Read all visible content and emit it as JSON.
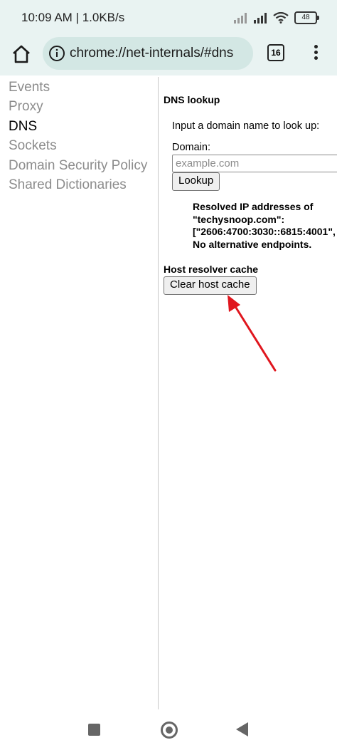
{
  "status_bar": {
    "time": "10:09 AM | 1.0KB/s",
    "battery": "48"
  },
  "toolbar": {
    "url": "chrome://net-internals/#dns",
    "tab_count": "16"
  },
  "sidebar": {
    "items": [
      {
        "label": "Events",
        "active": false
      },
      {
        "label": "Proxy",
        "active": false
      },
      {
        "label": "DNS",
        "active": true
      },
      {
        "label": "Sockets",
        "active": false
      },
      {
        "label": "Domain Security Policy",
        "active": false
      },
      {
        "label": "Shared Dictionaries",
        "active": false
      }
    ]
  },
  "dns_lookup": {
    "title": "DNS lookup",
    "instruction": "Input a domain name to look up:",
    "domain_label": "Domain:",
    "domain_placeholder": "example.com",
    "lookup_button": "Lookup",
    "result_lines": [
      "Resolved IP addresses of",
      "\"techysnoop.com\":",
      "[\"2606:4700:3030::6815:4001\",",
      "No alternative endpoints."
    ]
  },
  "host_cache": {
    "title": "Host resolver cache",
    "clear_button": "Clear host cache"
  },
  "colors": {
    "chrome_bg": "#e9f3f2",
    "omnibox_bg": "#d3e7e4",
    "annotation_arrow": "#e0161e",
    "inactive_nav": "#8c8c8c"
  }
}
